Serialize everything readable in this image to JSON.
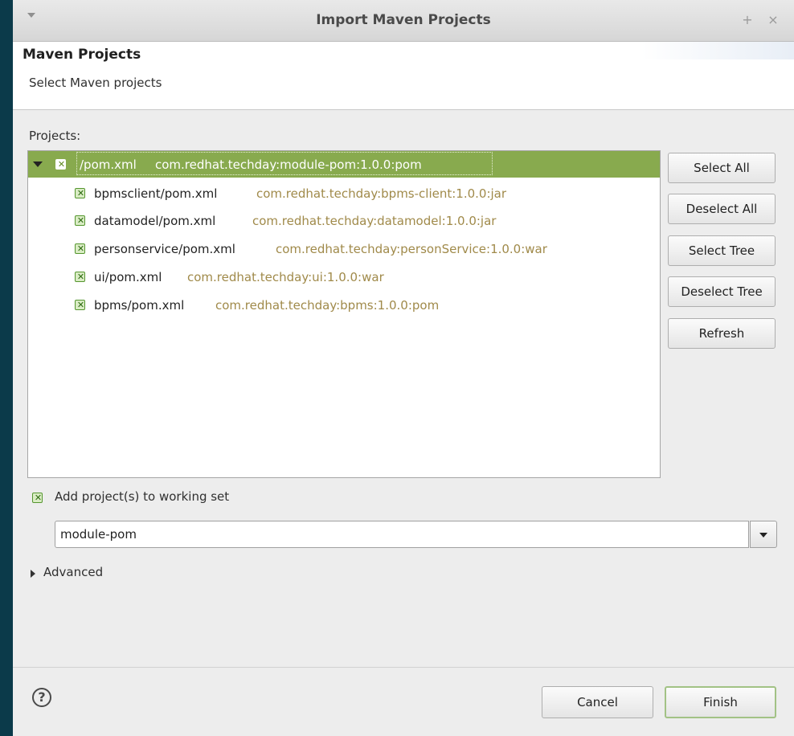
{
  "window": {
    "title": "Import Maven Projects",
    "pin_glyph": "+",
    "close_glyph": "×"
  },
  "header": {
    "title": "Maven Projects",
    "subtitle": "Select Maven projects"
  },
  "projects": {
    "label": "Projects:",
    "items": [
      {
        "name": "/pom.xml",
        "coord": "com.redhat.techday:module-pom:1.0.0:pom",
        "checked": true,
        "selected": true,
        "level": 0
      },
      {
        "name": "bpmsclient/pom.xml",
        "coord": "com.redhat.techday:bpms-client:1.0.0:jar",
        "checked": true,
        "selected": false,
        "level": 1
      },
      {
        "name": "datamodel/pom.xml",
        "coord": "com.redhat.techday:datamodel:1.0.0:jar",
        "checked": true,
        "selected": false,
        "level": 1
      },
      {
        "name": "personservice/pom.xml",
        "coord": "com.redhat.techday:personService:1.0.0:war",
        "checked": true,
        "selected": false,
        "level": 1
      },
      {
        "name": "ui/pom.xml",
        "coord": "com.redhat.techday:ui:1.0.0:war",
        "checked": true,
        "selected": false,
        "level": 1
      },
      {
        "name": "bpms/pom.xml",
        "coord": "com.redhat.techday:bpms:1.0.0:pom",
        "checked": true,
        "selected": false,
        "level": 1
      }
    ]
  },
  "side_buttons": {
    "select_all": "Select All",
    "deselect_all": "Deselect All",
    "select_tree": "Select Tree",
    "deselect_tree": "Deselect Tree",
    "refresh": "Refresh"
  },
  "working_set": {
    "label": "Add project(s) to working set",
    "checked": true,
    "value": "module-pom"
  },
  "advanced": {
    "label": "Advanced"
  },
  "footer": {
    "help_glyph": "?",
    "cancel": "Cancel",
    "finish": "Finish"
  },
  "colors": {
    "selection": "#88aa4e",
    "coordinate_text": "#a08a4a",
    "checkbox_border": "#55962f"
  }
}
